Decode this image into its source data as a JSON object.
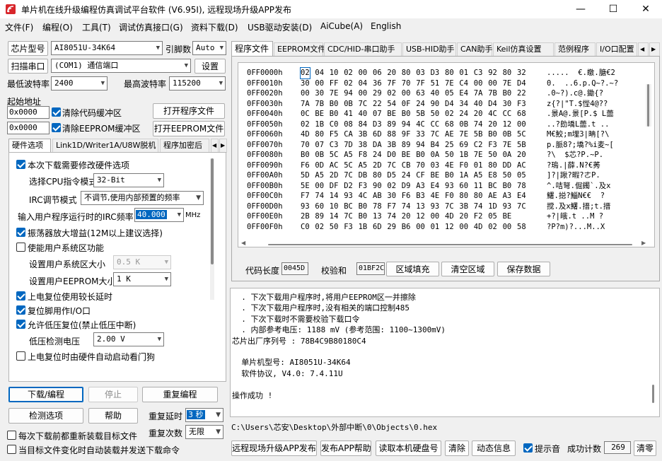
{
  "window": {
    "title": "单片机在线升级编程仿真调试平台软件 (V6.95I), 远程现场升级APP发布",
    "controls": [
      "—",
      "☐",
      "✕"
    ]
  },
  "menu": [
    "文件(F)",
    "编程(O)",
    "工具(T)",
    "调试仿真接口(G)",
    "资料下载(D)",
    "USB驱动安装(D)",
    "AiCube(A)",
    "English"
  ],
  "left": {
    "chip_label": "芯片型号",
    "chip_value": "AI8051U-34K64",
    "pins_label": "引脚数",
    "pins_value": "Auto",
    "scan_button": "扫描串口",
    "port_value": "(COM1) 通信端口",
    "settings_button": "设置",
    "min_baud_label": "最低波特率",
    "min_baud_value": "2400",
    "max_baud_label": "最高波特率",
    "max_baud_value": "115200",
    "start_addr_label": "起始地址",
    "addr1": "0x0000",
    "clear_code_label": "清除代码缓冲区",
    "open_prog_button": "打开程序文件",
    "addr2": "0x0000",
    "clear_eeprom_label": "清除EEPROM缓冲区",
    "open_eeprom_button": "打开EEPROM文件",
    "tabs": [
      "硬件选项",
      "Link1D/Writer1A/U8W脱机",
      "程序加密后"
    ],
    "options": {
      "modify_hw": "本次下载需要修改硬件选项",
      "cpu_mode_label": "选择CPU指令模式",
      "cpu_mode_value": "32-Bit",
      "irc_mode_label": "IRC调节模式",
      "irc_mode_value": "不调节,使用内部预置的频率",
      "irc_freq_label": "输入用户程序运行时的IRC频率",
      "irc_freq_value": "40.000",
      "irc_freq_unit": "MHz",
      "osc_gain": "振荡器放大增益(12M以上建议选择)",
      "enable_sys_area": "使能用户系统区功能",
      "sys_area_size_label": "设置用户系统区大小",
      "sys_area_size_value": "0.5 K",
      "eeprom_size_label": "设置用户EEPROM大小",
      "eeprom_size_value": "1   K",
      "long_delay": "上电复位使用较长延时",
      "reset_io": "复位脚用作I/O口",
      "low_volt_reset": "允许低压复位(禁止低压中断)",
      "low_volt_label": "低压检测电压",
      "low_volt_value": "2.00 V",
      "watchdog": "上电复位时由硬件自动启动看门狗"
    },
    "download_button": "下载/编程",
    "stop_button": "停止",
    "reprogram_button": "重复编程",
    "detect_button": "检测选项",
    "help_button": "帮助",
    "repeat_delay_label": "重复延时",
    "repeat_delay_value": "3 秒",
    "repeat_count_label": "重复次数",
    "repeat_count_value": "无限",
    "reload_each": "每次下载前都重新装载目标文件",
    "auto_reload": "当目标文件变化时自动装载并发送下载命令"
  },
  "right": {
    "tabs": [
      "程序文件",
      "EEPROM文件",
      "CDC/HID-串口助手",
      "USB-HID助手",
      "CAN助手",
      "Keil仿真设置",
      "范例程序",
      "I/O口配置"
    ],
    "hex_rows": [
      {
        "addr": "0FF0000h",
        "bytes": [
          "02",
          "04",
          "10",
          "02",
          "00",
          "06",
          "20",
          "80",
          "03",
          "D3",
          "80",
          "01",
          "C3",
          "92",
          "80",
          "32"
        ],
        "ascii": ".....  €.皦.膅€2"
      },
      {
        "addr": "0FF0010h",
        "bytes": [
          "30",
          "00",
          "FF",
          "02",
          "04",
          "36",
          "7F",
          "70",
          "7F",
          "51",
          "7E",
          "C4",
          "00",
          "00",
          "7E",
          "D4"
        ],
        "ascii": "0.  ..6.p.Q~?.~?"
      },
      {
        "addr": "0FF0020h",
        "bytes": [
          "00",
          "30",
          "7E",
          "94",
          "00",
          "29",
          "02",
          "00",
          "63",
          "40",
          "05",
          "E4",
          "7A",
          "7B",
          "B0",
          "22"
        ],
        "ascii": ".0~?).c@.鋤{?"
      },
      {
        "addr": "0FF0030h",
        "bytes": [
          "7A",
          "7B",
          "B0",
          "0B",
          "7C",
          "22",
          "54",
          "0F",
          "24",
          "90",
          "D4",
          "34",
          "40",
          "D4",
          "30",
          "F3"
        ],
        "ascii": "z{?|\"T.$悂4@??"
      },
      {
        "addr": "0FF0040h",
        "bytes": [
          "0C",
          "BE",
          "B0",
          "41",
          "40",
          "07",
          "BE",
          "B0",
          "5B",
          "50",
          "02",
          "24",
          "20",
          "4C",
          "CC",
          "68"
        ],
        "ascii": ".景A@.景[P.$ L蘦"
      },
      {
        "addr": "0FF0050h",
        "bytes": [
          "02",
          "1B",
          "C0",
          "08",
          "84",
          "D3",
          "89",
          "94",
          "4C",
          "CC",
          "68",
          "0B",
          "74",
          "20",
          "12",
          "00"
        ],
        "ascii": "..?勆墧L蘦.t .."
      },
      {
        "addr": "0FF0060h",
        "bytes": [
          "4D",
          "80",
          "F5",
          "CA",
          "3B",
          "6D",
          "88",
          "9F",
          "33",
          "7C",
          "AE",
          "7E",
          "5B",
          "B0",
          "0B",
          "5C"
        ],
        "ascii": "M€鮫;m埋3|畘[?\\"
      },
      {
        "addr": "0FF0070h",
        "bytes": [
          "70",
          "07",
          "C3",
          "7D",
          "38",
          "DA",
          "3B",
          "89",
          "94",
          "B4",
          "25",
          "69",
          "C2",
          "F3",
          "7E",
          "5B"
        ],
        "ascii": "p.脈8?;墧?%i麦~["
      },
      {
        "addr": "0FF0080h",
        "bytes": [
          "B0",
          "0B",
          "5C",
          "A5",
          "F8",
          "24",
          "D0",
          "BE",
          "B0",
          "0A",
          "50",
          "1B",
          "7E",
          "50",
          "0A",
          "20"
        ],
        "ascii": "?\\  $芯?P.~P. "
      },
      {
        "addr": "0FF0090h",
        "bytes": [
          "F6",
          "0D",
          "AC",
          "5C",
          "A5",
          "2D",
          "7C",
          "CB",
          "70",
          "03",
          "4E",
          "F0",
          "01",
          "80",
          "DD",
          "AC"
        ],
        "ascii": "?瑦.|薛.N?€莠"
      },
      {
        "addr": "0FF00A0h",
        "bytes": [
          "5D",
          "A5",
          "2D",
          "7C",
          "DB",
          "80",
          "D5",
          "24",
          "CF",
          "BE",
          "B0",
          "1A",
          "A5",
          "E8",
          "50",
          "05"
        ],
        "ascii": "]?|踿?暇?ㄜP."
      },
      {
        "addr": "0FF00B0h",
        "bytes": [
          "5E",
          "00",
          "DF",
          "D2",
          "F3",
          "90",
          "02",
          "D9",
          "A3",
          "E4",
          "93",
          "60",
          "11",
          "BC",
          "B0",
          "78"
        ],
        "ascii": "^.咭弩.倔鐲`.及x"
      },
      {
        "addr": "0FF00C0h",
        "bytes": [
          "F7",
          "74",
          "14",
          "93",
          "4C",
          "AB",
          "30",
          "F6",
          "B3",
          "4E",
          "F0",
          "80",
          "80",
          "AE",
          "A3",
          "E4"
        ],
        "ascii": "鱰.搃?鯔N€€  ?"
      },
      {
        "addr": "0FF00D0h",
        "bytes": [
          "93",
          "60",
          "10",
          "BC",
          "B0",
          "78",
          "F7",
          "74",
          "13",
          "93",
          "7C",
          "3B",
          "74",
          "1D",
          "93",
          "7C"
        ],
        "ascii": "搅.及x鱰.搢;t.搢"
      },
      {
        "addr": "0FF00E0h",
        "bytes": [
          "2B",
          "89",
          "14",
          "7C",
          "B0",
          "13",
          "74",
          "20",
          "12",
          "00",
          "4D",
          "20",
          "F2",
          "05",
          "BE",
          " "
        ],
        "ascii": "+?|皒.t ..M ?"
      },
      {
        "addr": "0FF00F0h",
        "bytes": [
          "C0",
          "02",
          "50",
          "F3",
          "1B",
          "6D",
          "29",
          "B6",
          "00",
          "01",
          "12",
          "00",
          "4D",
          "02",
          "00",
          "58"
        ],
        "ascii": "?P?m)?...M..X"
      }
    ],
    "code_len_label": "代码长度",
    "code_len_value": "0045D",
    "checksum_label": "校验和",
    "checksum_value": "01BF2C",
    "fill_button": "区域填充",
    "clear_area_button": "清空区域",
    "save_button": "保存数据",
    "log_lines": [
      "  . 下次下载用户程序时,将用户EEPROM区一并擦除",
      "  . 下次下载用户程序时,没有相关的端口控制485",
      "  . 下次下载时不需要校验下载口令",
      "  . 内部参考电压: 1188 mV (参考范围: 1100~1300mV)",
      "芯片出厂序列号 : 78B4C9B80180C4",
      "",
      "  单片机型号: AI8051U-34K64",
      "  软件协议, V4.0: 7.4.11U",
      "",
      "操作成功 !"
    ],
    "file_path": "C:\\Users\\芯安\\Desktop\\外部中断\\0\\Objects\\0.hex",
    "publish_app_button": "远程现场升级APP发布",
    "publish_help_button": "发布APP帮助",
    "read_disk_button": "读取本机硬盘号",
    "clear_button": "清除",
    "dynamic_button": "动态信息",
    "prompt_sound_label": "提示音",
    "success_count_label": "成功计数",
    "success_count_value": "269",
    "reset_count_button": "清零"
  }
}
